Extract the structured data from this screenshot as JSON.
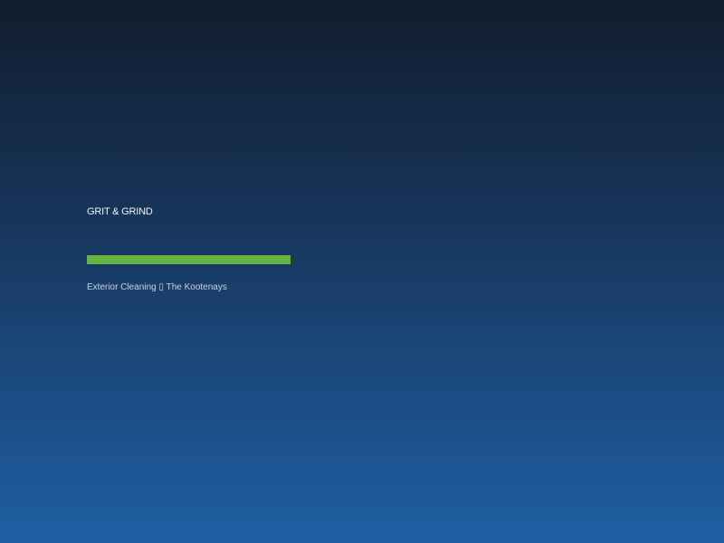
{
  "brand": {
    "name": "GRIT & GRIND"
  },
  "loader": {
    "progress": 1.0,
    "fill_color": "#65b443"
  },
  "tagline": "Exterior Cleaning ▯ The Kootenays",
  "colors": {
    "background_top": "#121d2e",
    "background_bottom": "#1f5fa3",
    "text": "#f2f5fa"
  }
}
